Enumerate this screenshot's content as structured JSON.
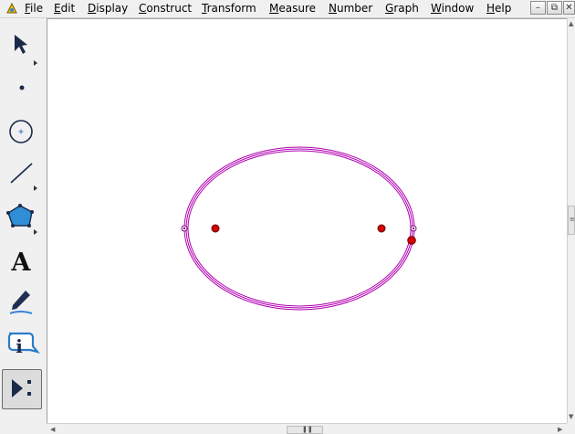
{
  "menu": {
    "items": [
      {
        "label": "File",
        "key": "F"
      },
      {
        "label": "Edit",
        "key": "E"
      },
      {
        "label": "Display",
        "key": "D"
      },
      {
        "label": "Construct",
        "key": "C"
      },
      {
        "label": "Transform",
        "key": "T"
      },
      {
        "label": "Measure",
        "key": "M"
      },
      {
        "label": "Number",
        "key": "N"
      },
      {
        "label": "Graph",
        "key": "G"
      },
      {
        "label": "Window",
        "key": "W"
      },
      {
        "label": "Help",
        "key": "H"
      }
    ],
    "window_controls": [
      "minimize",
      "restore",
      "close"
    ]
  },
  "toolbox": {
    "tools": [
      {
        "name": "arrow-tool",
        "icon": "arrow-icon"
      },
      {
        "name": "point-tool",
        "icon": "point-icon"
      },
      {
        "name": "compass-tool",
        "icon": "circle-icon"
      },
      {
        "name": "straightedge-tool",
        "icon": "segment-icon"
      },
      {
        "name": "polygon-tool",
        "icon": "polygon-icon"
      },
      {
        "name": "text-tool",
        "icon": "text-icon",
        "glyph": "A"
      },
      {
        "name": "marker-tool",
        "icon": "marker-icon"
      },
      {
        "name": "information-tool",
        "icon": "info-icon",
        "glyph": "i"
      },
      {
        "name": "custom-tool",
        "icon": "custom-tools-icon",
        "active": true
      }
    ]
  },
  "canvas": {
    "locus_color": "#b000b0",
    "point_color": "#cc0000",
    "locus_shape": "ellipse",
    "points": 3
  }
}
